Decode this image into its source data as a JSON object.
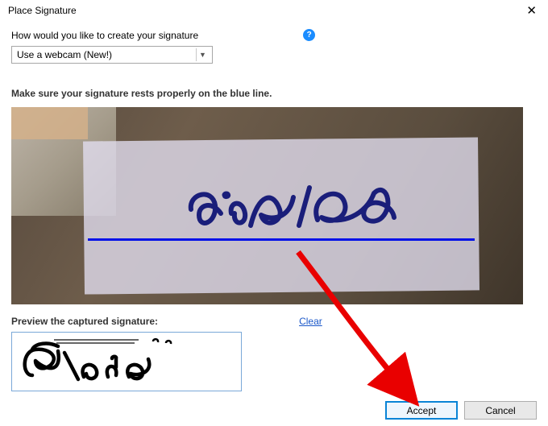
{
  "title": "Place Signature",
  "question_label": "How would you like to create your signature",
  "help_icon_char": "?",
  "combo_value": "Use a webcam (New!)",
  "instruction": "Make sure your signature rests properly on the blue line.",
  "preview_label": "Preview the captured signature:",
  "clear_link": "Clear",
  "accept_label": "Accept",
  "cancel_label": "Cancel"
}
